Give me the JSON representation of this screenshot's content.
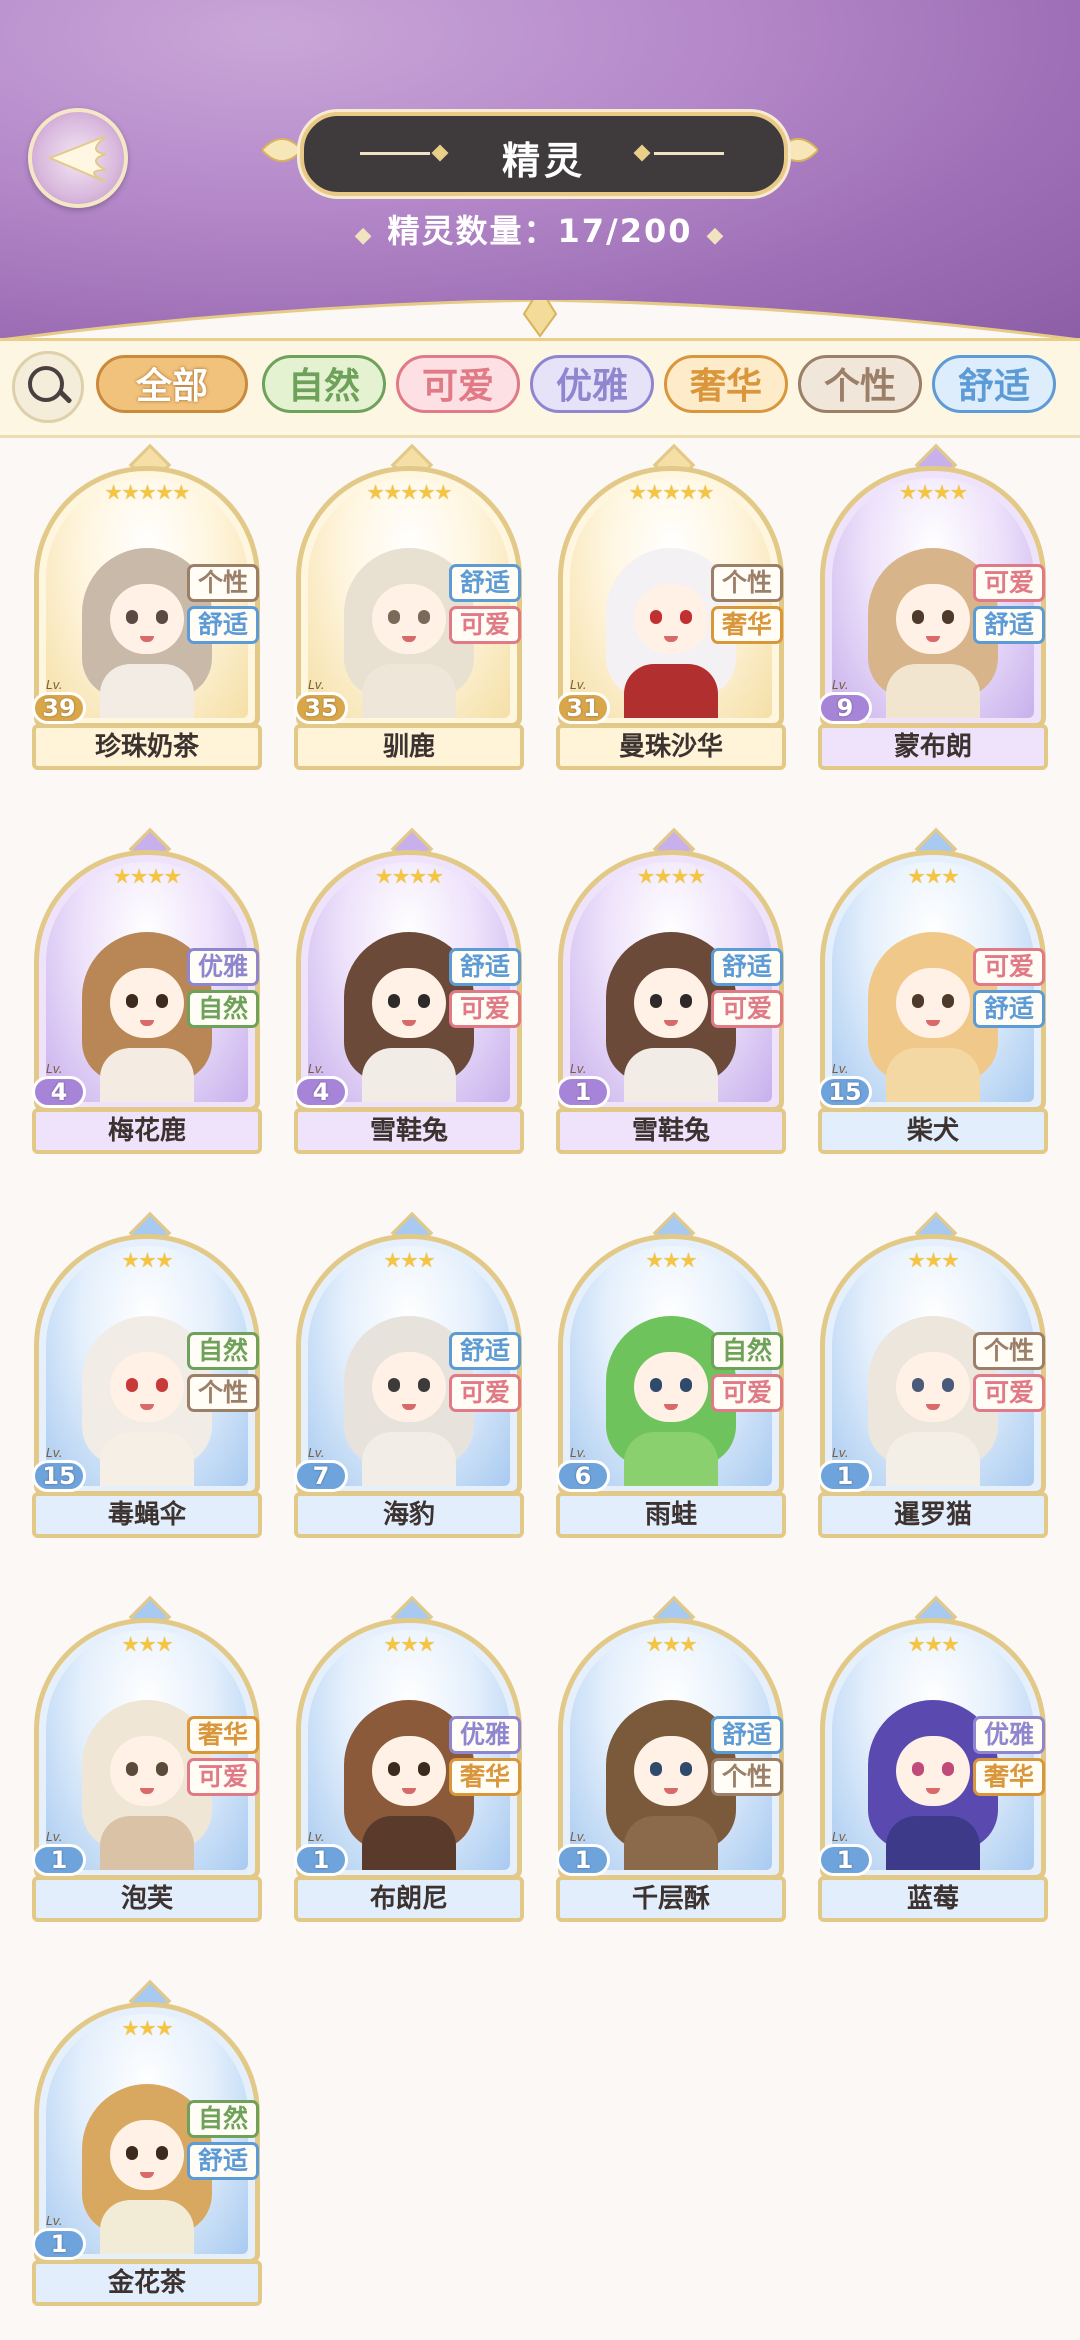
{
  "header": {
    "title": "精灵",
    "count_label": "精灵数量：17/200"
  },
  "filters": [
    {
      "label": "全部",
      "active": true,
      "color": "#c98a3b",
      "bg": "#f1c27c"
    },
    {
      "label": "自然",
      "color": "#6ea25a",
      "bg": "#e4f2d2"
    },
    {
      "label": "可爱",
      "color": "#e07a86",
      "bg": "#fde0e3"
    },
    {
      "label": "优雅",
      "color": "#8f86d0",
      "bg": "#e6e2f8"
    },
    {
      "label": "奢华",
      "color": "#d9963a",
      "bg": "#fdebc9"
    },
    {
      "label": "个性",
      "color": "#9b7f69",
      "bg": "#f1e6da"
    },
    {
      "label": "舒适",
      "color": "#5d9bd6",
      "bg": "#ddedfb"
    }
  ],
  "spirits": [
    {
      "name": "珍珠奶茶",
      "level": "39",
      "stars": "★★★★★",
      "rarity": "gold",
      "tags": [
        "个性",
        "舒适"
      ]
    },
    {
      "name": "驯鹿",
      "level": "35",
      "stars": "★★★★★",
      "rarity": "gold",
      "tags": [
        "舒适",
        "可爱"
      ]
    },
    {
      "name": "曼珠沙华",
      "level": "31",
      "stars": "★★★★★",
      "rarity": "gold",
      "tags": [
        "个性",
        "奢华"
      ]
    },
    {
      "name": "蒙布朗",
      "level": "9",
      "stars": "★★★★",
      "rarity": "purple",
      "tags": [
        "可爱",
        "舒适"
      ]
    },
    {
      "name": "梅花鹿",
      "level": "4",
      "stars": "★★★★",
      "rarity": "purple",
      "tags": [
        "优雅",
        "自然"
      ]
    },
    {
      "name": "雪鞋兔",
      "level": "4",
      "stars": "★★★★",
      "rarity": "purple",
      "tags": [
        "舒适",
        "可爱"
      ]
    },
    {
      "name": "雪鞋兔",
      "level": "1",
      "stars": "★★★★",
      "rarity": "purple",
      "tags": [
        "舒适",
        "可爱"
      ]
    },
    {
      "name": "柴犬",
      "level": "15",
      "stars": "★★★",
      "rarity": "blue",
      "tags": [
        "可爱",
        "舒适"
      ]
    },
    {
      "name": "毒蝇伞",
      "level": "15",
      "stars": "★★★",
      "rarity": "blue",
      "tags": [
        "自然",
        "个性"
      ]
    },
    {
      "name": "海豹",
      "level": "7",
      "stars": "★★★",
      "rarity": "blue",
      "tags": [
        "舒适",
        "可爱"
      ]
    },
    {
      "name": "雨蛙",
      "level": "6",
      "stars": "★★★",
      "rarity": "blue",
      "tags": [
        "自然",
        "可爱"
      ]
    },
    {
      "name": "暹罗猫",
      "level": "1",
      "stars": "★★★",
      "rarity": "blue",
      "tags": [
        "个性",
        "可爱"
      ]
    },
    {
      "name": "泡芙",
      "level": "1",
      "stars": "★★★",
      "rarity": "blue",
      "tags": [
        "奢华",
        "可爱"
      ]
    },
    {
      "name": "布朗尼",
      "level": "1",
      "stars": "★★★",
      "rarity": "blue",
      "tags": [
        "优雅",
        "奢华"
      ]
    },
    {
      "name": "千层酥",
      "level": "1",
      "stars": "★★★",
      "rarity": "blue",
      "tags": [
        "舒适",
        "个性"
      ]
    },
    {
      "name": "蓝莓",
      "level": "1",
      "stars": "★★★",
      "rarity": "blue",
      "tags": [
        "优雅",
        "奢华"
      ]
    },
    {
      "name": "金花茶",
      "level": "1",
      "stars": "★★★",
      "rarity": "blue",
      "tags": [
        "自然",
        "舒适"
      ]
    }
  ],
  "tag_colors": {
    "自然": "#6ea25a",
    "可爱": "#e07a86",
    "优雅": "#8f86d0",
    "奢华": "#d9963a",
    "个性": "#9b7f69",
    "舒适": "#5d9bd6"
  },
  "rarity_colors": {
    "gold": {
      "bg": "#fff6e0",
      "bg2": "#f5dfa6",
      "name": "#fff3d8",
      "lv": "#d9a64a"
    },
    "purple": {
      "bg": "#eee3fb",
      "bg2": "#c8b0ec",
      "name": "#efe2fb",
      "lv": "#a684d8"
    },
    "blue": {
      "bg": "#e5f0fc",
      "bg2": "#a8caf0",
      "name": "#e2eefc",
      "lv": "#6ea3dc"
    }
  }
}
